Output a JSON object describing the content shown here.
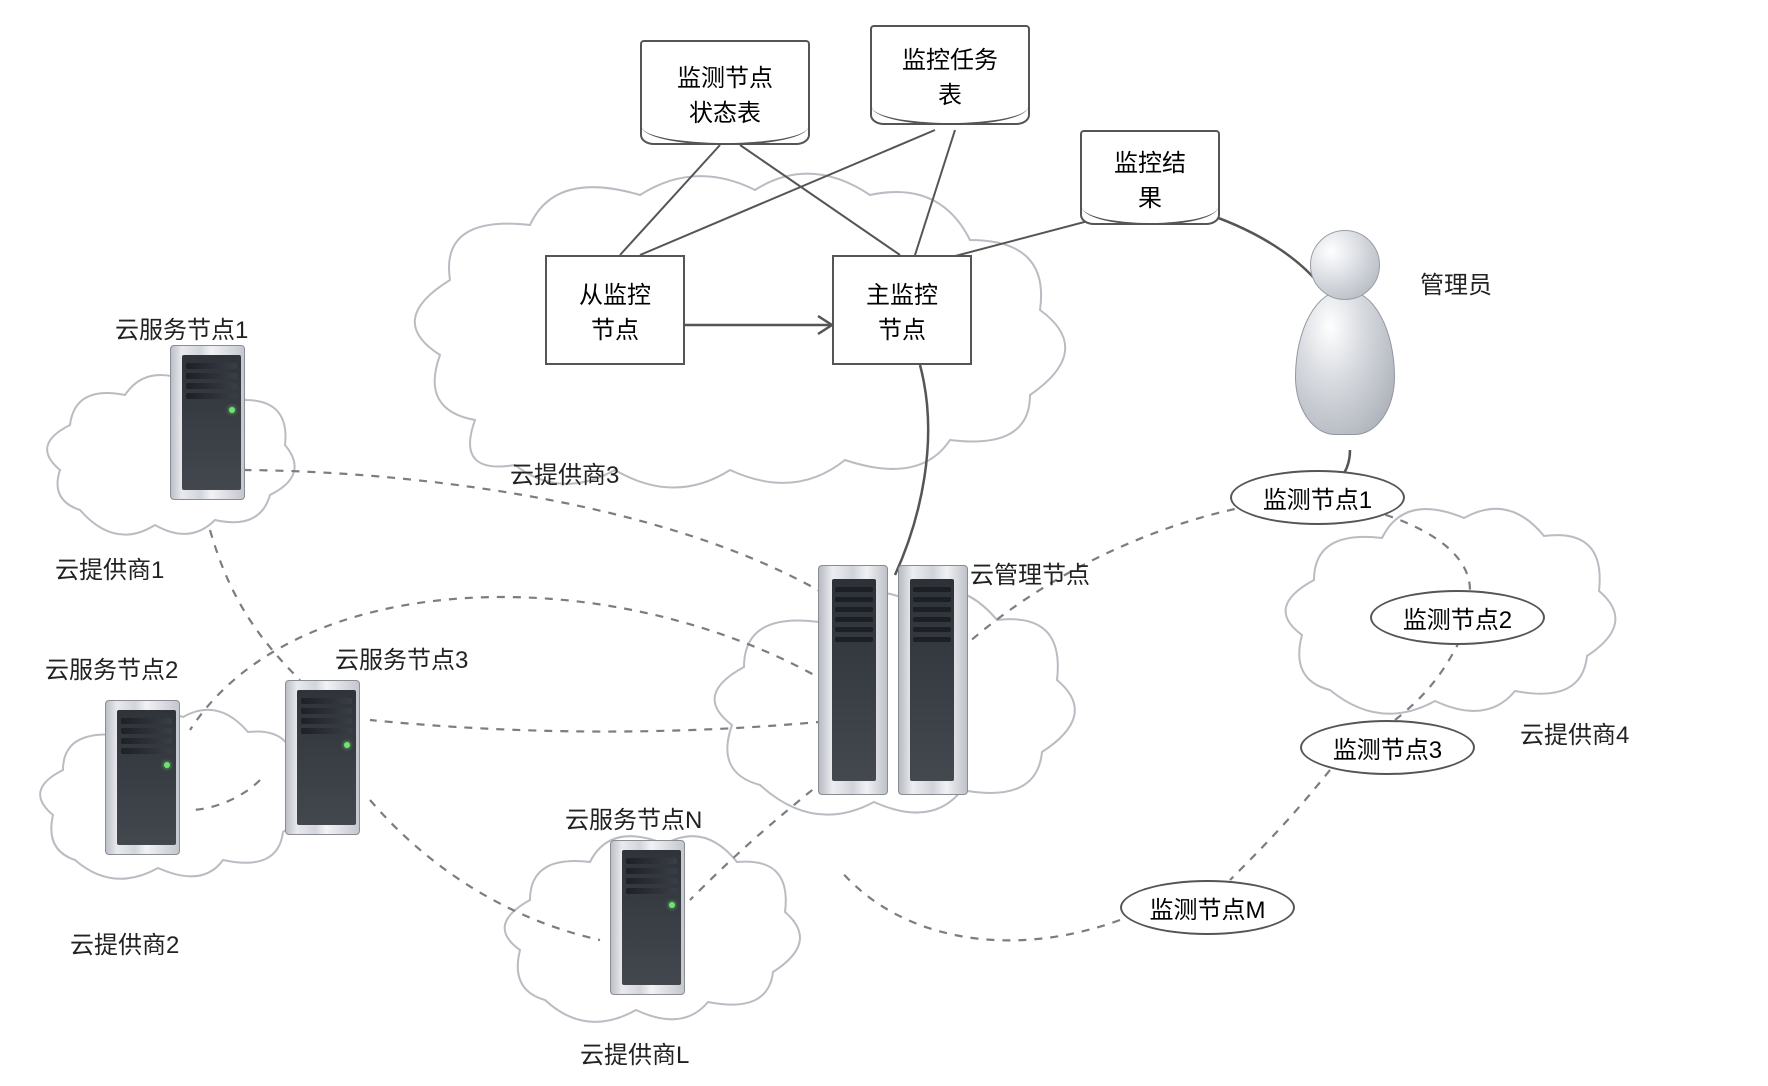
{
  "labels": {
    "admin": "管理员",
    "cloud_mgmt_node": "云管理节点",
    "cloud_provider_1": "云提供商1",
    "cloud_provider_2": "云提供商2",
    "cloud_provider_3": "云提供商3",
    "cloud_provider_4": "云提供商4",
    "cloud_provider_L": "云提供商L",
    "cloud_service_node_1": "云服务节点1",
    "cloud_service_node_2": "云服务节点2",
    "cloud_service_node_3": "云服务节点3",
    "cloud_service_node_N": "云服务节点N"
  },
  "docs": {
    "monitor_node_status_table": "监测节点\n状态表",
    "monitor_task_table": "监控任务\n表",
    "monitor_result": "监控结\n果"
  },
  "boxes": {
    "slave_monitor_node": "从监控\n节点",
    "master_monitor_node": "主监控\n节点"
  },
  "ellipses": {
    "monitor_node_1": "监测节点1",
    "monitor_node_2": "监测节点2",
    "monitor_node_3": "监测节点3",
    "monitor_node_M": "监测节点M"
  }
}
